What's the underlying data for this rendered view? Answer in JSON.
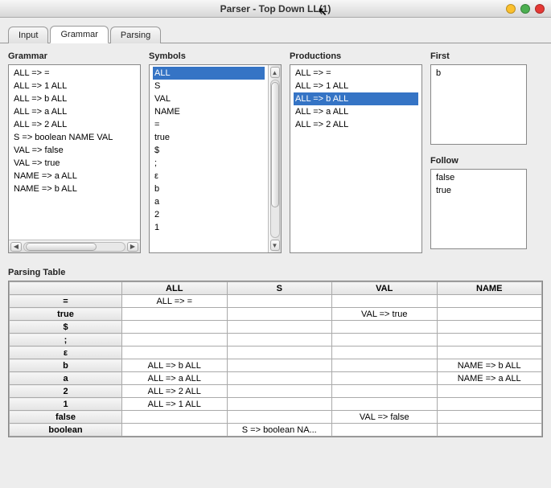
{
  "window": {
    "title": "Parser - Top Down LL(1)"
  },
  "tabs": [
    {
      "label": "Input",
      "active": false
    },
    {
      "label": "Grammar",
      "active": true
    },
    {
      "label": "Parsing",
      "active": false
    }
  ],
  "panels": {
    "grammar": {
      "title": "Grammar",
      "items": [
        "ALL => =",
        "ALL => 1 ALL",
        "ALL => b ALL",
        "ALL => a ALL",
        "ALL => 2 ALL",
        "S => boolean NAME VAL",
        "VAL => false",
        "VAL => true",
        "NAME => a ALL",
        "NAME => b ALL"
      ]
    },
    "symbols": {
      "title": "Symbols",
      "items": [
        "ALL",
        "S",
        "VAL",
        "NAME",
        "=",
        "true",
        "$",
        ";",
        "ε",
        "b",
        "a",
        "2",
        "1"
      ],
      "selected": 0
    },
    "productions": {
      "title": "Productions",
      "items": [
        "ALL => =",
        "ALL => 1 ALL",
        "ALL => b ALL",
        "ALL => a ALL",
        "ALL => 2 ALL"
      ],
      "selected": 2
    },
    "first": {
      "title": "First",
      "items": [
        "b"
      ]
    },
    "follow": {
      "title": "Follow",
      "items": [
        "false",
        "true"
      ]
    }
  },
  "parsing_table": {
    "title": "Parsing Table",
    "columns": [
      "ALL",
      "S",
      "VAL",
      "NAME"
    ],
    "rows": [
      {
        "hdr": "=",
        "cells": [
          "ALL => =",
          "",
          "",
          ""
        ]
      },
      {
        "hdr": "true",
        "cells": [
          "",
          "",
          "VAL => true",
          ""
        ]
      },
      {
        "hdr": "$",
        "cells": [
          "",
          "",
          "",
          ""
        ]
      },
      {
        "hdr": ";",
        "cells": [
          "",
          "",
          "",
          ""
        ]
      },
      {
        "hdr": "ε",
        "cells": [
          "",
          "",
          "",
          ""
        ]
      },
      {
        "hdr": "b",
        "cells": [
          "ALL => b ALL",
          "",
          "",
          "NAME => b ALL"
        ]
      },
      {
        "hdr": "a",
        "cells": [
          "ALL => a ALL",
          "",
          "",
          "NAME => a ALL"
        ]
      },
      {
        "hdr": "2",
        "cells": [
          "ALL => 2 ALL",
          "",
          "",
          ""
        ]
      },
      {
        "hdr": "1",
        "cells": [
          "ALL => 1 ALL",
          "",
          "",
          ""
        ]
      },
      {
        "hdr": "false",
        "cells": [
          "",
          "",
          "VAL => false",
          ""
        ]
      },
      {
        "hdr": "boolean",
        "cells": [
          "",
          "S => boolean NA...",
          "",
          ""
        ]
      }
    ]
  }
}
